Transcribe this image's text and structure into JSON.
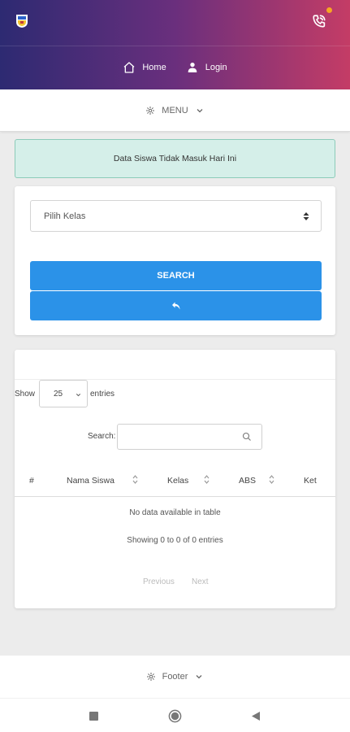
{
  "header": {
    "icons": {
      "logo": "school-crest-icon",
      "phone": "phone-call-icon"
    },
    "accent_gradient": [
      "#2d2a72",
      "#6a2f7d",
      "#c43c66"
    ],
    "notification_color": "#f6a623",
    "nav": [
      {
        "label": "Home",
        "icon": "home-icon"
      },
      {
        "label": "Login",
        "icon": "user-login-icon"
      }
    ]
  },
  "menu": {
    "label": "MENU",
    "icon": "gear-icon"
  },
  "alert": {
    "text": "Data Siswa Tidak Masuk Hari Ini",
    "color": "#d5efe9"
  },
  "filter": {
    "select_value": "Pilih Kelas",
    "search_button": "SEARCH",
    "back_icon": "undo-arrow-icon",
    "button_color": "#2b92e8"
  },
  "table": {
    "show_label": "Show",
    "page_length": "25",
    "entries_label": "entries",
    "search_label": "Search:",
    "search_value": "",
    "columns": [
      "#",
      "Nama Siswa",
      "Kelas",
      "ABS",
      "Ket"
    ],
    "empty_text": "No data available in table",
    "info": "Showing 0 to 0 of 0 entries",
    "pagination": {
      "previous": "Previous",
      "next": "Next"
    }
  },
  "footer": {
    "label": "Footer",
    "icon": "gear-icon"
  }
}
